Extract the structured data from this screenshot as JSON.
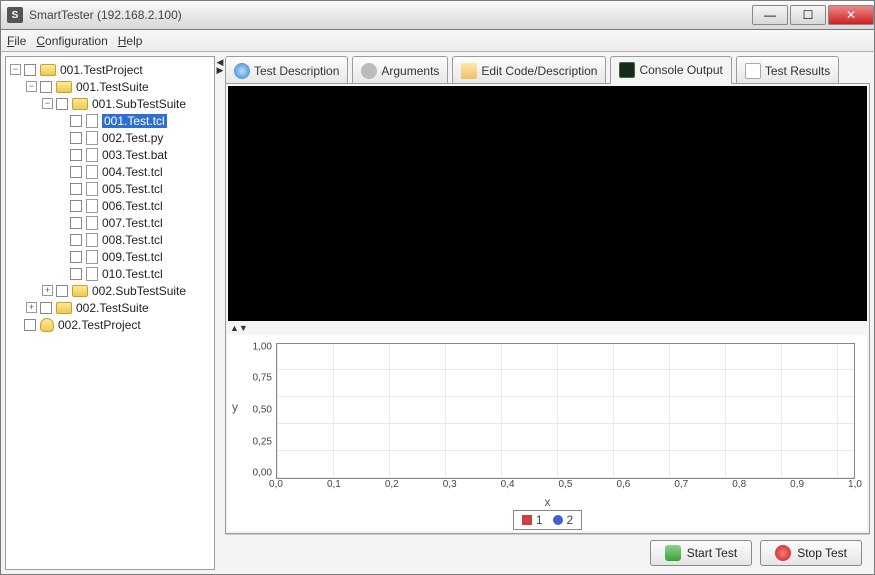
{
  "window": {
    "title": "SmartTester (192.168.2.100)"
  },
  "menu": {
    "file": "File",
    "config": "Configuration",
    "help": "Help"
  },
  "tree": {
    "n0": "001.TestProject",
    "n1": "001.TestSuite",
    "n2": "001.SubTestSuite",
    "f1": "001.Test.tcl",
    "f2": "002.Test.py",
    "f3": "003.Test.bat",
    "f4": "004.Test.tcl",
    "f5": "005.Test.tcl",
    "f6": "006.Test.tcl",
    "f7": "007.Test.tcl",
    "f8": "008.Test.tcl",
    "f9": "009.Test.tcl",
    "f10": "010.Test.tcl",
    "n3": "002.SubTestSuite",
    "n4": "002.TestSuite",
    "n5": "002.TestProject"
  },
  "tabs": {
    "desc": "Test Description",
    "args": "Arguments",
    "edit": "Edit Code/Description",
    "console": "Console Output",
    "results": "Test Results"
  },
  "buttons": {
    "start": "Start Test",
    "stop": "Stop Test"
  },
  "chart_data": {
    "type": "line",
    "title": "",
    "xlabel": "x",
    "ylabel": "y",
    "xlim": [
      0.0,
      1.0
    ],
    "ylim": [
      0.0,
      1.0
    ],
    "xticks": [
      "0,0",
      "0,1",
      "0,2",
      "0,3",
      "0,4",
      "0,5",
      "0,6",
      "0,7",
      "0,8",
      "0,9",
      "1,0"
    ],
    "yticks": [
      "0,00",
      "0,25",
      "0,50",
      "0,75",
      "1,00"
    ],
    "series": [
      {
        "name": "1",
        "values": []
      },
      {
        "name": "2",
        "values": []
      }
    ],
    "legend": [
      "1",
      "2"
    ]
  }
}
